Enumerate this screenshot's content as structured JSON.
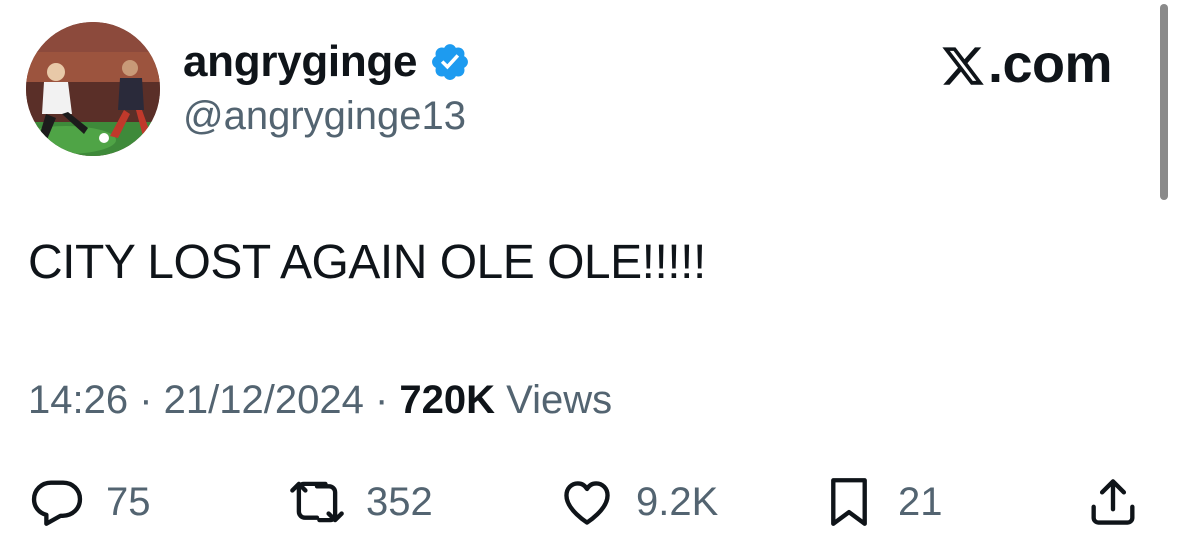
{
  "author": {
    "display_name": "angryginge",
    "handle": "@angryginge13",
    "verified": true,
    "verified_color": "#1d9bf0"
  },
  "brand": {
    "label": ".com",
    "icon": "x-logo-icon"
  },
  "tweet": {
    "text": "CITY LOST AGAIN OLE OLE!!!!!"
  },
  "meta": {
    "time": "14:26",
    "separator": " · ",
    "date": "21/12/2024",
    "views_count": "720K",
    "views_label": " Views"
  },
  "actions": {
    "replies": {
      "icon": "reply-icon",
      "count": "75"
    },
    "reposts": {
      "icon": "repost-icon",
      "count": "352"
    },
    "likes": {
      "icon": "heart-icon",
      "count": "9.2K"
    },
    "bookmarks": {
      "icon": "bookmark-icon",
      "count": "21"
    },
    "share": {
      "icon": "share-icon"
    }
  },
  "colors": {
    "text": "#0f1419",
    "secondary": "#536471",
    "verified": "#1d9bf0"
  }
}
